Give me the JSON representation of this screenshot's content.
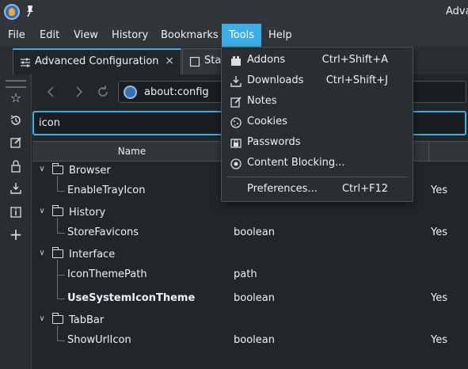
{
  "window": {
    "title": "Adva"
  },
  "menubar": {
    "items": [
      "File",
      "Edit",
      "View",
      "History",
      "Bookmarks",
      "Tools",
      "Help"
    ],
    "active": "Tools"
  },
  "tabs": [
    {
      "label": "Advanced Configuration",
      "close": "×"
    },
    {
      "label": "Star"
    }
  ],
  "navbar": {
    "url": "about:config"
  },
  "search": {
    "value": "icon"
  },
  "table": {
    "headers": [
      "Name"
    ],
    "rows": [
      {
        "name": "Browser",
        "type": "",
        "value": "",
        "folder": true
      },
      {
        "name": "EnableTrayIcon",
        "type": "",
        "value": "Yes",
        "folder": false
      },
      {
        "name": "History",
        "type": "",
        "value": "",
        "folder": true
      },
      {
        "name": "StoreFavicons",
        "type": "boolean",
        "value": "Yes",
        "folder": false
      },
      {
        "name": "Interface",
        "type": "",
        "value": "",
        "folder": true
      },
      {
        "name": "IconThemePath",
        "type": "path",
        "value": "",
        "folder": false
      },
      {
        "name": "UseSystemIconTheme",
        "type": "boolean",
        "value": "Yes",
        "folder": false,
        "bold": true
      },
      {
        "name": "TabBar",
        "type": "",
        "value": "",
        "folder": true
      },
      {
        "name": "ShowUrlIcon",
        "type": "boolean",
        "value": "Yes",
        "folder": false
      }
    ]
  },
  "tools_menu": {
    "items": [
      {
        "label": "Addons",
        "shortcut": "Ctrl+Shift+A",
        "icon": "addons-icon"
      },
      {
        "label": "Downloads",
        "shortcut": "Ctrl+Shift+J",
        "icon": "downloads-icon"
      },
      {
        "label": "Notes",
        "shortcut": "",
        "icon": "notes-icon"
      },
      {
        "label": "Cookies",
        "shortcut": "",
        "icon": "cookies-icon"
      },
      {
        "label": "Passwords",
        "shortcut": "",
        "icon": "passwords-icon"
      },
      {
        "label": "Content Blocking...",
        "shortcut": "",
        "icon": "shield-icon"
      },
      {
        "label": "Preferences...",
        "shortcut": "Ctrl+F12",
        "icon": ""
      }
    ]
  },
  "colors": {
    "accent": "#3daee9",
    "background": "#232629",
    "panel": "#31363b"
  }
}
